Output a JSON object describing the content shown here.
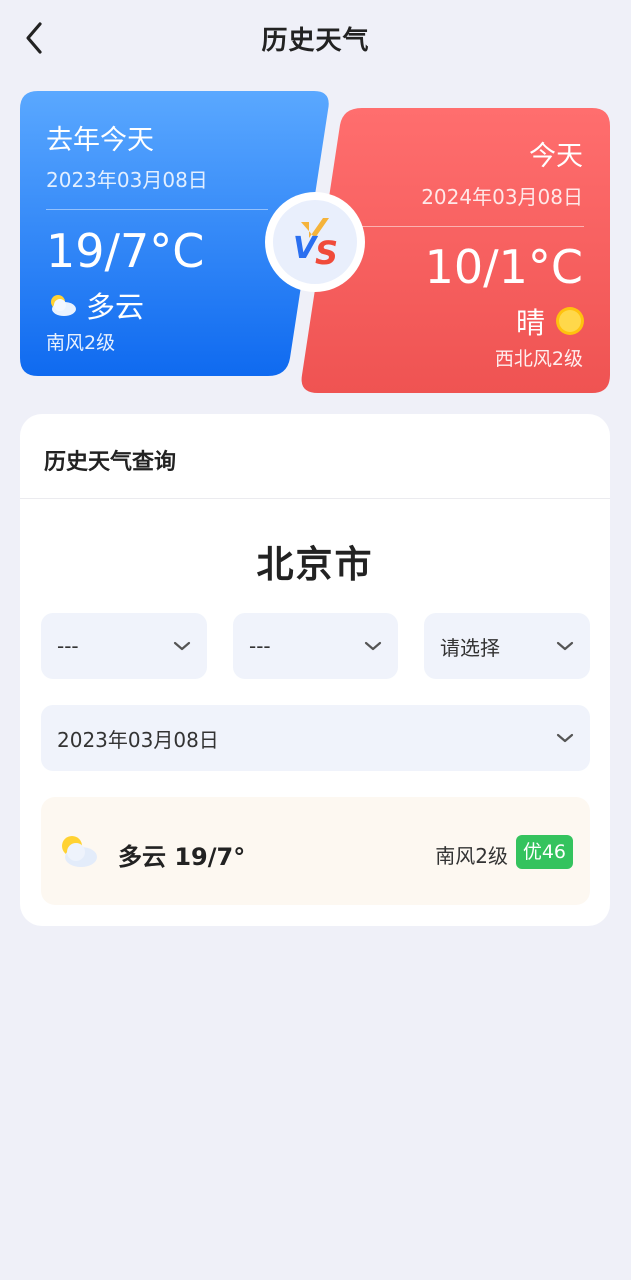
{
  "header": {
    "title": "历史天气"
  },
  "last_year": {
    "title": "去年今天",
    "date": "2023年03月08日",
    "temp": "19/7°C",
    "condition": "多云",
    "condition_icon": "partly-cloudy-icon",
    "wind": "南风2级"
  },
  "today": {
    "title": "今天",
    "date": "2024年03月08日",
    "temp": "10/1°C",
    "condition": "晴",
    "condition_icon": "sun-icon",
    "wind": "西北风2级"
  },
  "vs_badge_text": "VS",
  "query": {
    "title": "历史天气查询",
    "city": "北京市",
    "province_select": "---",
    "city_select": "---",
    "district_select": "请选择",
    "date_select": "2023年03月08日",
    "result": {
      "condition_temp": "多云 19/7°",
      "wind": "南风2级",
      "aqi": "优46"
    }
  },
  "colors": {
    "background": "#eff0f8",
    "last_year_card": "#1f78f5",
    "today_card": "#f25a55",
    "aqi_good": "#34c35e",
    "result_bg": "#fdf8f1"
  }
}
